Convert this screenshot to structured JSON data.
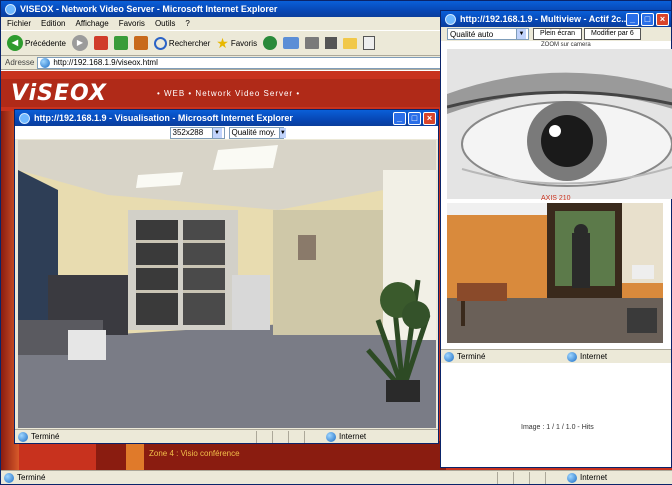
{
  "colors": {
    "xp_blue": "#0a5fd8",
    "brand_red": "#c8321e",
    "taskbar": "#245edb"
  },
  "main_window": {
    "title": "VISEOX - Network Video Server - Microsoft Internet Explorer",
    "menu": [
      "Fichier",
      "Edition",
      "Affichage",
      "Favoris",
      "Outils",
      "?"
    ],
    "toolbar": {
      "back": "Précédente",
      "search": "Rechercher",
      "favorites": "Favoris"
    },
    "address_label": "Adresse",
    "address_value": "http://192.168.1.9/viseox.html",
    "logo": "ViSEOX",
    "banner": "• WEB • Network Video Server •",
    "footer_text": "Zone 4 : Visio conférence",
    "status_text": "Terminé",
    "status_zone": "Internet"
  },
  "visual_window": {
    "title": "http://192.168.1.9 - Visualisation - Microsoft Internet Explorer",
    "select1": "352x288",
    "select2": "Qualité moy.",
    "status_text": "Terminé",
    "status_zone": "Internet"
  },
  "multi_window": {
    "title": "http://192.168.1.9 - Multiview - Actif 2c...",
    "quality_select": "Qualité auto",
    "button1": "Plein écran",
    "button2": "Modifier par 6",
    "cam1_label": "ZOOM sur camera",
    "cam2_label": "AXIS 210",
    "status_text": "Terminé",
    "status_zone": "Internet",
    "info_text": "Image : 1 / 1 / 1.0 - Hits"
  },
  "taskbar": {
    "start": "Terminé",
    "zone": "Internet"
  }
}
